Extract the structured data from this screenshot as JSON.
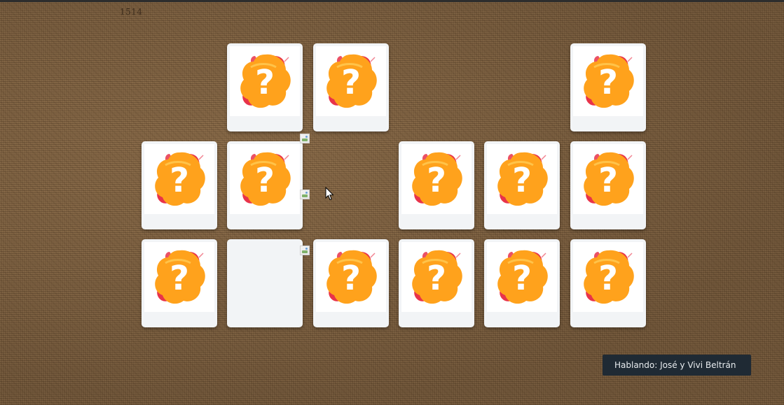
{
  "counter_text": "1514",
  "subtitle_text": "Hablando: José y Vivi Beltrán",
  "card_back_symbol": "?",
  "colors": {
    "burlap": "#7d6142",
    "card_bg": "#f2f4f6",
    "blob_orange": "#ffa21c",
    "blob_red": "#e8334a",
    "subtitle_bg": "#1f2a34"
  },
  "board": {
    "rows": 3,
    "cols": 6,
    "cards": [
      {
        "row": 0,
        "col": 0,
        "state": "removed"
      },
      {
        "row": 0,
        "col": 1,
        "state": "face-down"
      },
      {
        "row": 0,
        "col": 2,
        "state": "face-down"
      },
      {
        "row": 0,
        "col": 3,
        "state": "removed"
      },
      {
        "row": 0,
        "col": 4,
        "state": "removed"
      },
      {
        "row": 0,
        "col": 5,
        "state": "face-down"
      },
      {
        "row": 1,
        "col": 0,
        "state": "face-down"
      },
      {
        "row": 1,
        "col": 1,
        "state": "face-down"
      },
      {
        "row": 1,
        "col": 2,
        "state": "removed"
      },
      {
        "row": 1,
        "col": 3,
        "state": "face-down"
      },
      {
        "row": 1,
        "col": 4,
        "state": "face-down"
      },
      {
        "row": 1,
        "col": 5,
        "state": "face-down"
      },
      {
        "row": 2,
        "col": 0,
        "state": "face-down"
      },
      {
        "row": 2,
        "col": 1,
        "state": "empty"
      },
      {
        "row": 2,
        "col": 2,
        "state": "face-down"
      },
      {
        "row": 2,
        "col": 3,
        "state": "face-down"
      },
      {
        "row": 2,
        "col": 4,
        "state": "face-down"
      },
      {
        "row": 2,
        "col": 5,
        "state": "face-down"
      }
    ]
  }
}
